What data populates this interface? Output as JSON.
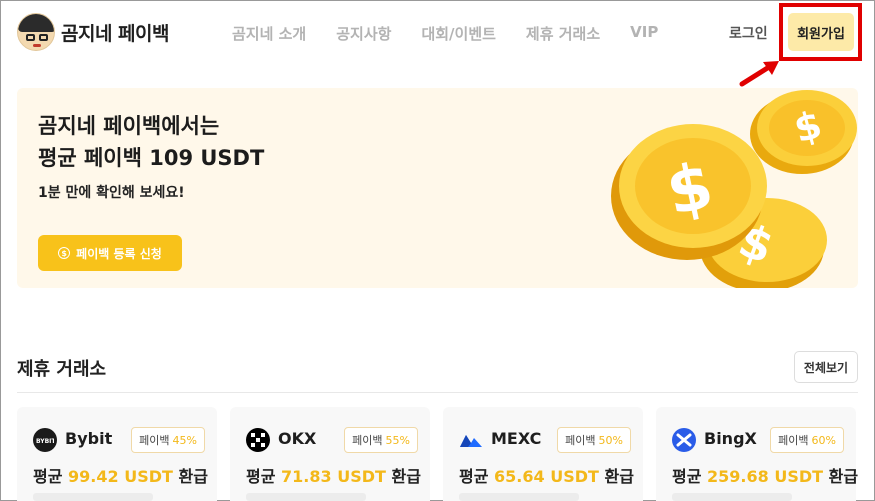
{
  "brand": {
    "name": "곰지네 페이백"
  },
  "nav": [
    "곰지네 소개",
    "공지사항",
    "대회/이벤트",
    "제휴 거래소",
    "VIP"
  ],
  "auth": {
    "login": "로그인",
    "signup": "회원가입"
  },
  "hero": {
    "title_line1": "곰지네 페이백에서는",
    "title_line2": "평균 페이백 109 USDT",
    "subtitle": "1분 만에 확인해 보세요!",
    "button_label": "페이백 등록 신청"
  },
  "section": {
    "title": "제휴 거래소",
    "view_all": "전체보기"
  },
  "exchanges": [
    {
      "name": "Bybit",
      "badge_label": "페이백",
      "badge_pct": "45%",
      "avg_prefix": "평균",
      "avg_value": "99.42 USDT",
      "avg_suffix": "환급",
      "logo_color": "#1a1a1a",
      "logo_icon": "bybit-logo"
    },
    {
      "name": "OKX",
      "badge_label": "페이백",
      "badge_pct": "55%",
      "avg_prefix": "평균",
      "avg_value": "71.83 USDT",
      "avg_suffix": "환급",
      "logo_color": "#000000",
      "logo_icon": "okx-logo"
    },
    {
      "name": "MEXC",
      "badge_label": "페이백",
      "badge_pct": "50%",
      "avg_prefix": "평균",
      "avg_value": "65.64 USDT",
      "avg_suffix": "환급",
      "logo_color": "#1f6bff",
      "logo_icon": "mexc-logo"
    },
    {
      "name": "BingX",
      "badge_label": "페이백",
      "badge_pct": "60%",
      "avg_prefix": "평균",
      "avg_value": "259.68 USDT",
      "avg_suffix": "환급",
      "logo_color": "#2a5ce8",
      "logo_icon": "bingx-logo"
    }
  ],
  "colors": {
    "accent": "#f8c21a",
    "highlight": "#e00000",
    "signup_bg": "#fdeaa8",
    "hero_bg": "#fff8ea"
  }
}
